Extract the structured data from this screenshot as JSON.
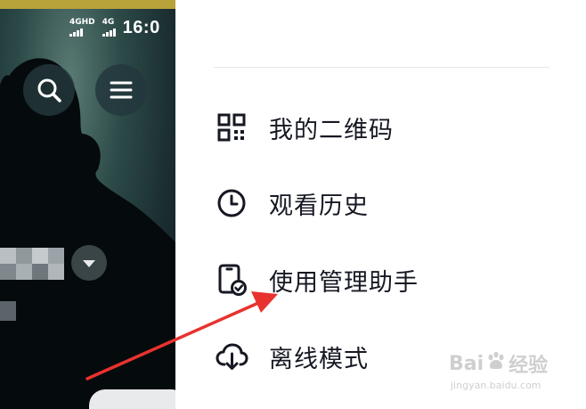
{
  "background_app": {
    "status_bar": {
      "signal_1_label": "4GHD",
      "signal_2_label": "4G",
      "time": "16:0"
    },
    "buttons": {
      "search_icon": "search-icon",
      "menu_icon": "hamburger-menu-icon",
      "dropdown_icon": "chevron-down-icon"
    }
  },
  "side_menu": {
    "items": [
      {
        "label": "我的二维码",
        "icon": "qr-code-icon"
      },
      {
        "label": "观看历史",
        "icon": "clock-icon"
      },
      {
        "label": "使用管理助手",
        "icon": "phone-check-icon"
      },
      {
        "label": "离线模式",
        "icon": "cloud-download-icon"
      }
    ]
  },
  "annotation": {
    "arrow_color": "#e8322e",
    "points_to": "使用管理助手"
  },
  "watermark": {
    "brand_left": "Bai",
    "brand_right": "经验",
    "url": "jingyan.baidu.com"
  },
  "colors": {
    "menu_text": "#161823",
    "divider": "#e6e6e6",
    "left_panel": "#1e3236",
    "arrow": "#e8322e"
  }
}
